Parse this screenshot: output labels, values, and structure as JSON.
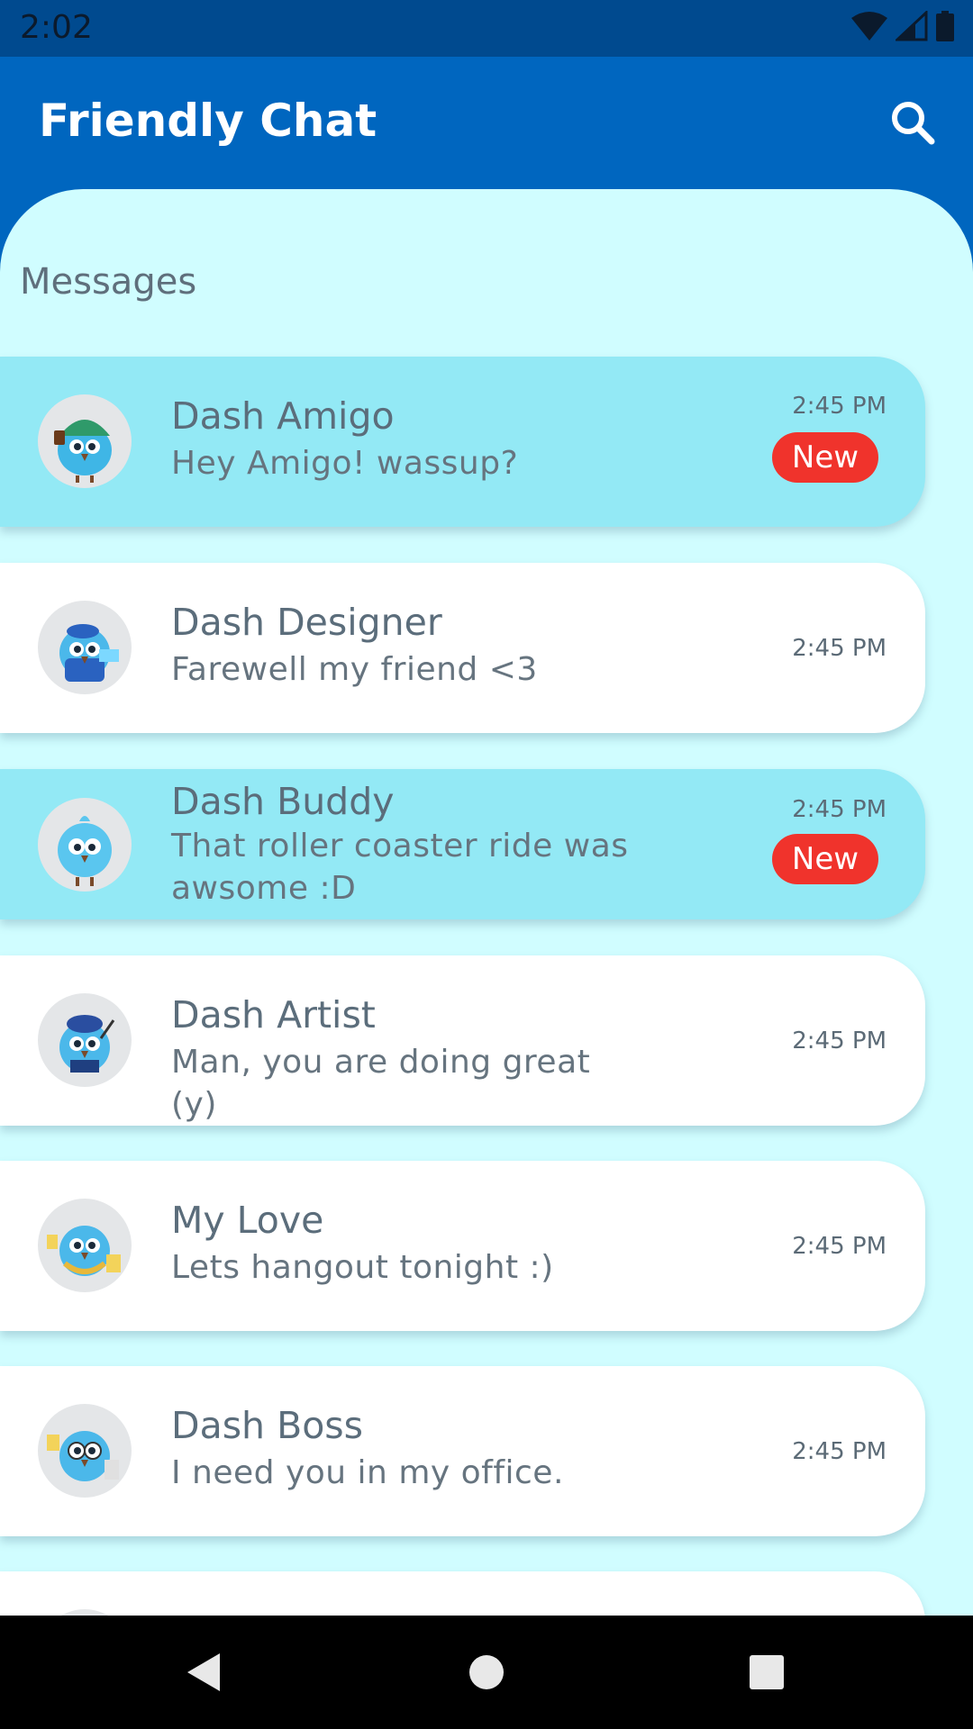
{
  "status_bar": {
    "time": "2:02"
  },
  "app_bar": {
    "title": "Friendly Chat",
    "search_icon": "search-icon"
  },
  "section": {
    "title": "Messages"
  },
  "conversations": [
    {
      "name": "Dash Amigo",
      "message": "Hey Amigo! wassup?",
      "time": "2:45 PM",
      "badge": "New",
      "unread": true
    },
    {
      "name": "Dash Designer",
      "message": "Farewell my friend <3",
      "time": "2:45 PM",
      "unread": false
    },
    {
      "name": "Dash Buddy",
      "message": "That roller coaster ride was awsome :D",
      "time": "2:45 PM",
      "badge": "New",
      "unread": true
    },
    {
      "name": "Dash Artist",
      "message": "Man, you are doing great (y)",
      "time": "2:45 PM",
      "unread": false
    },
    {
      "name": "My Love",
      "message": "Lets hangout tonight :)",
      "time": "2:45 PM",
      "unread": false
    },
    {
      "name": "Dash Boss",
      "message": "I need you in my office.",
      "time": "2:45 PM",
      "unread": false
    }
  ],
  "colors": {
    "app_bar": "#0066bf",
    "status_bar": "#004a8f",
    "content_bg": "#d0fdff",
    "unread_card": "#93e9f5",
    "badge": "#f0332c"
  },
  "nav_bar": {
    "back_icon": "back-triangle-icon",
    "home_icon": "home-circle-icon",
    "recents_icon": "recents-square-icon"
  }
}
